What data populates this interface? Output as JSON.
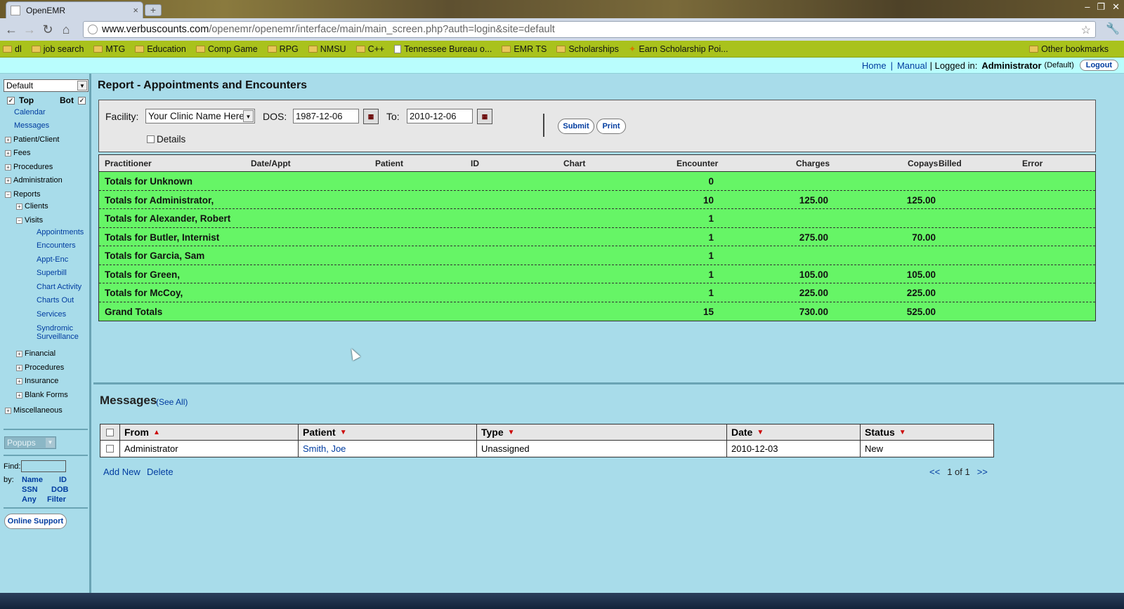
{
  "browser": {
    "tab_title": "OpenEMR",
    "tab_close": "×",
    "new_tab": "+",
    "url_host": "www.verbuscounts.com",
    "url_path": "/openemr/openemr/interface/main/main_screen.php?auth=login&site=default",
    "window_controls": [
      "–",
      "❐",
      "✕"
    ],
    "nav_icons": [
      "back-icon",
      "forward-icon",
      "reload-icon",
      "home-icon"
    ],
    "bookmarks": [
      {
        "label": "dl",
        "icon": "folder-icon"
      },
      {
        "label": "job search",
        "icon": "folder-icon"
      },
      {
        "label": "MTG",
        "icon": "folder-icon"
      },
      {
        "label": "Education",
        "icon": "folder-icon"
      },
      {
        "label": "Comp Game",
        "icon": "folder-icon"
      },
      {
        "label": "RPG",
        "icon": "folder-icon"
      },
      {
        "label": "NMSU",
        "icon": "folder-icon"
      },
      {
        "label": "C++",
        "icon": "folder-icon"
      },
      {
        "label": "Tennessee Bureau o...",
        "icon": "page-icon"
      },
      {
        "label": "EMR TS",
        "icon": "folder-icon"
      },
      {
        "label": "Scholarships",
        "icon": "folder-icon"
      },
      {
        "label": "Earn Scholarship Poi...",
        "icon": "star-icon"
      }
    ],
    "other_bookmarks": "Other bookmarks"
  },
  "header": {
    "home": "Home",
    "sep": "|",
    "manual": "Manual",
    "logged_in_label": "| Logged in:",
    "user": "Administrator",
    "user_group": "(Default)",
    "logout": "Logout"
  },
  "leftnav": {
    "layout_select": "Default",
    "top_label": "Top",
    "bot_label": "Bot",
    "top_checked": true,
    "bot_checked": true,
    "calendar": "Calendar",
    "messages": "Messages",
    "patient_client": "Patient/Client",
    "fees": "Fees",
    "procedures": "Procedures",
    "administration": "Administration",
    "reports": "Reports",
    "clients": "Clients",
    "visits": "Visits",
    "visit_items": [
      "Appointments",
      "Encounters",
      "Appt-Enc",
      "Superbill",
      "Chart Activity",
      "Charts Out",
      "Services"
    ],
    "syndromic_1": "Syndromic",
    "syndromic_2": "Surveillance",
    "financial": "Financial",
    "procedures2": "Procedures",
    "insurance": "Insurance",
    "blank_forms": "Blank Forms",
    "miscellaneous": "Miscellaneous",
    "popups": "Popups",
    "find_label": "Find:",
    "by_label": "by:",
    "by_name": "Name",
    "by_id": "ID",
    "by_ssn": "SSN",
    "by_dob": "DOB",
    "by_any": "Any",
    "by_filter": "Filter",
    "online_support": "Online Support"
  },
  "report": {
    "title": "Report - Appointments and Encounters",
    "facility_label": "Facility:",
    "facility_value": "Your Clinic Name Here",
    "dos_label": "DOS:",
    "dos_from": "1987-12-06",
    "to_label": "To:",
    "dos_to": "2010-12-06",
    "details_label": "Details",
    "details_checked": false,
    "submit": "Submit",
    "print": "Print",
    "columns": [
      "Practitioner",
      "Date/Appt",
      "Patient",
      "ID",
      "Chart",
      "Encounter",
      "Charges",
      "Copays",
      "Billed",
      "Error"
    ],
    "rows": [
      {
        "label": "Totals for Unknown",
        "encounter": "0",
        "charges": "",
        "copays": ""
      },
      {
        "label": "Totals for Administrator,",
        "encounter": "10",
        "charges": "125.00",
        "copays": "125.00"
      },
      {
        "label": "Totals for Alexander, Robert",
        "encounter": "1",
        "charges": "",
        "copays": ""
      },
      {
        "label": "Totals for Butler, Internist",
        "encounter": "1",
        "charges": "275.00",
        "copays": "70.00"
      },
      {
        "label": "Totals for Garcia, Sam",
        "encounter": "1",
        "charges": "",
        "copays": ""
      },
      {
        "label": "Totals for Green,",
        "encounter": "1",
        "charges": "105.00",
        "copays": "105.00"
      },
      {
        "label": "Totals for McCoy,",
        "encounter": "1",
        "charges": "225.00",
        "copays": "225.00"
      },
      {
        "label": "Grand Totals",
        "encounter": "15",
        "charges": "730.00",
        "copays": "525.00"
      }
    ]
  },
  "messages": {
    "title": "Messages",
    "see_all": "(See All)",
    "columns": [
      "From",
      "Patient",
      "Type",
      "Date",
      "Status"
    ],
    "rows": [
      {
        "from": "Administrator",
        "patient": "Smith, Joe",
        "type": "Unassigned",
        "date": "2010-12-03",
        "status": "New"
      }
    ],
    "add_new": "Add New",
    "delete": "Delete",
    "pager_prev": "<<",
    "pager_info": "1 of 1",
    "pager_next": ">>"
  },
  "colors": {
    "app_bg": "#a8dcea",
    "report_rows": "#66f566",
    "bookmark_bar": "#a9c21c",
    "header_bar": "#b9fdfd",
    "link": "#003ca0",
    "sort_arrow": "#cc0000"
  }
}
